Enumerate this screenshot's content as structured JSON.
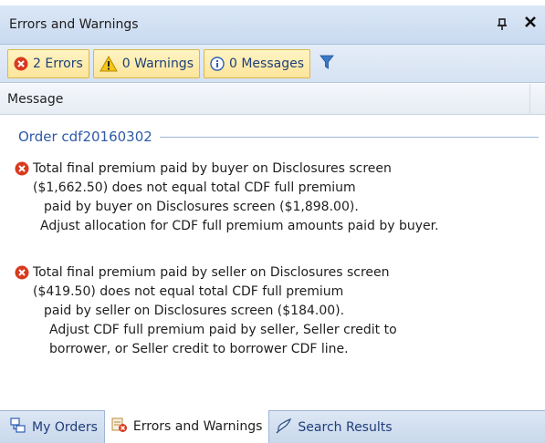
{
  "panel": {
    "title": "Errors and Warnings",
    "pin_glyph": "ᵽ",
    "close_glyph": "✕"
  },
  "toolbar": {
    "errors_label": "2 Errors",
    "warnings_label": "0 Warnings",
    "messages_label": "0 Messages"
  },
  "columns": {
    "message": "Message"
  },
  "group": {
    "title": "Order cdf20160302"
  },
  "messages": [
    {
      "type": "error",
      "lines": [
        "Total final premium paid by buyer on Disclosures screen",
        "($1,662.50) does not equal total CDF full premium",
        "paid by buyer on Disclosures screen ($1,898.00).",
        "Adjust allocation for CDF full premium amounts paid by buyer."
      ]
    },
    {
      "type": "error",
      "lines": [
        "Total final premium paid by seller on Disclosures screen",
        "($419.50) does not equal total CDF full premium",
        "paid by seller on Disclosures screen ($184.00).",
        "Adjust CDF full premium paid by seller, Seller credit to",
        "borrower, or Seller credit to borrower CDF line."
      ]
    }
  ],
  "tabs": [
    {
      "label": "My Orders",
      "icon": "orders-icon"
    },
    {
      "label": "Errors and Warnings",
      "icon": "errors-warnings-icon"
    },
    {
      "label": "Search Results",
      "icon": "search-results-icon"
    }
  ],
  "colors": {
    "error_red": "#d93a1e",
    "warning_yellow": "#f5c518",
    "info_blue": "#2f5fb3",
    "link_blue": "#2e5aa8"
  }
}
